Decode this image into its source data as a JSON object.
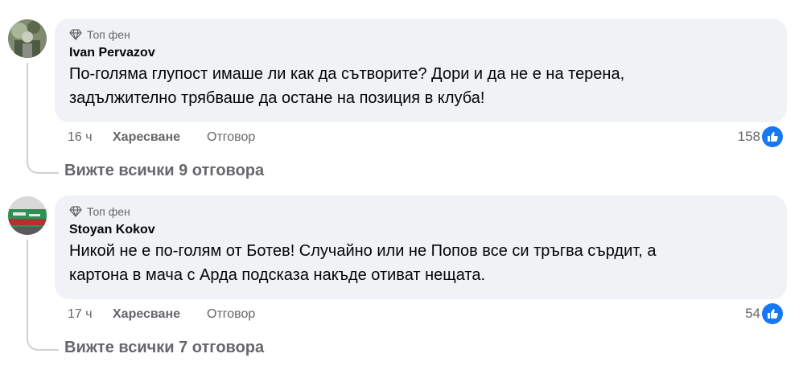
{
  "comments": [
    {
      "badge": "Топ фен",
      "author": "Ivan Pervazov",
      "text_line1": "По-голяма глупост имаше ли как да сътворите? Дори и да не е на терена,",
      "text_line2": "задължително трябваше да остане на позиция в клуба!",
      "time": "16 ч",
      "like_label": "Харесване",
      "reply_label": "Отговор",
      "reactions": "158",
      "view_replies": "Вижте всички 9 отговора"
    },
    {
      "badge": "Топ фен",
      "author": "Stoyan Kokov",
      "text_line1": "Никой не е по-голям от Ботев! Случайно или не Попов все си тръгва сърдит, а",
      "text_line2": "картона в мача с Арда подсказа накъде отиват нещата.",
      "time": "17 ч",
      "like_label": "Харесване",
      "reply_label": "Отговор",
      "reactions": "54",
      "view_replies": "Вижте всички 7 отговора"
    }
  ],
  "colors": {
    "bubble": "#f0f2f5",
    "secondary_text": "#65676b",
    "like_blue": "#1877f2"
  },
  "icons": [
    "diamond-icon",
    "like-reaction-icon"
  ]
}
